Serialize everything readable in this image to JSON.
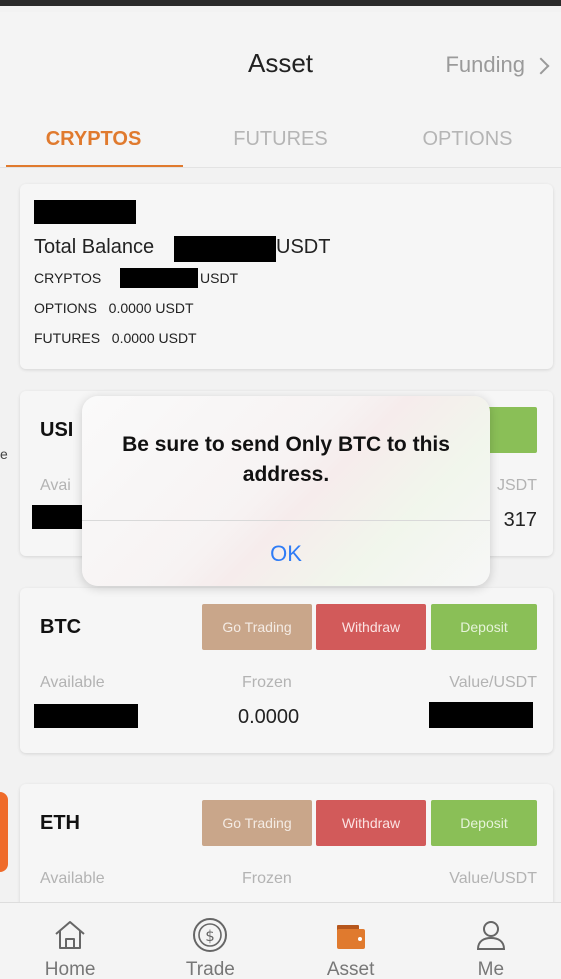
{
  "header": {
    "title": "Asset",
    "right_label": "Funding"
  },
  "tabs": [
    {
      "label": "CRYPTOS"
    },
    {
      "label": "FUTURES"
    },
    {
      "label": "OPTIONS"
    }
  ],
  "balance": {
    "total_label": "Total Balance",
    "total_unit": "USDT",
    "cryptos_label": "CRYPTOS",
    "cryptos_unit": "USDT",
    "options_line": "OPTIONS   0.0000 USDT",
    "futures_line": "FUTURES   0.0000 USDT"
  },
  "coins": [
    {
      "name": "USDT",
      "visible_name": "USI",
      "available_label": "Avai",
      "value_label": "JSDT",
      "value_partial": "317"
    },
    {
      "name": "BTC",
      "trade_label": "Go Trading",
      "withdraw_label": "Withdraw",
      "deposit_label": "Deposit",
      "available_label": "Available",
      "frozen_label": "Frozen",
      "value_label": "Value/USDT",
      "frozen_value": "0.0000"
    },
    {
      "name": "ETH",
      "trade_label": "Go Trading",
      "withdraw_label": "Withdraw",
      "deposit_label": "Deposit",
      "available_label": "Available",
      "frozen_label": "Frozen",
      "value_label": "Value/USDT"
    }
  ],
  "dialog": {
    "message": "Be sure to send Only BTC to this address.",
    "ok_label": "OK"
  },
  "nav": [
    {
      "label": "Home",
      "icon": "home-icon"
    },
    {
      "label": "Trade",
      "icon": "dollar-coin-icon"
    },
    {
      "label": "Asset",
      "icon": "wallet-icon"
    },
    {
      "label": "Me",
      "icon": "user-icon"
    }
  ],
  "stray_text": "e",
  "colors": {
    "accent": "#e07a2e",
    "trade_btn": "#c9a68a",
    "withdraw_btn": "#d25a5a",
    "deposit_btn": "#8abf57",
    "ok_link": "#2f7cf6"
  }
}
